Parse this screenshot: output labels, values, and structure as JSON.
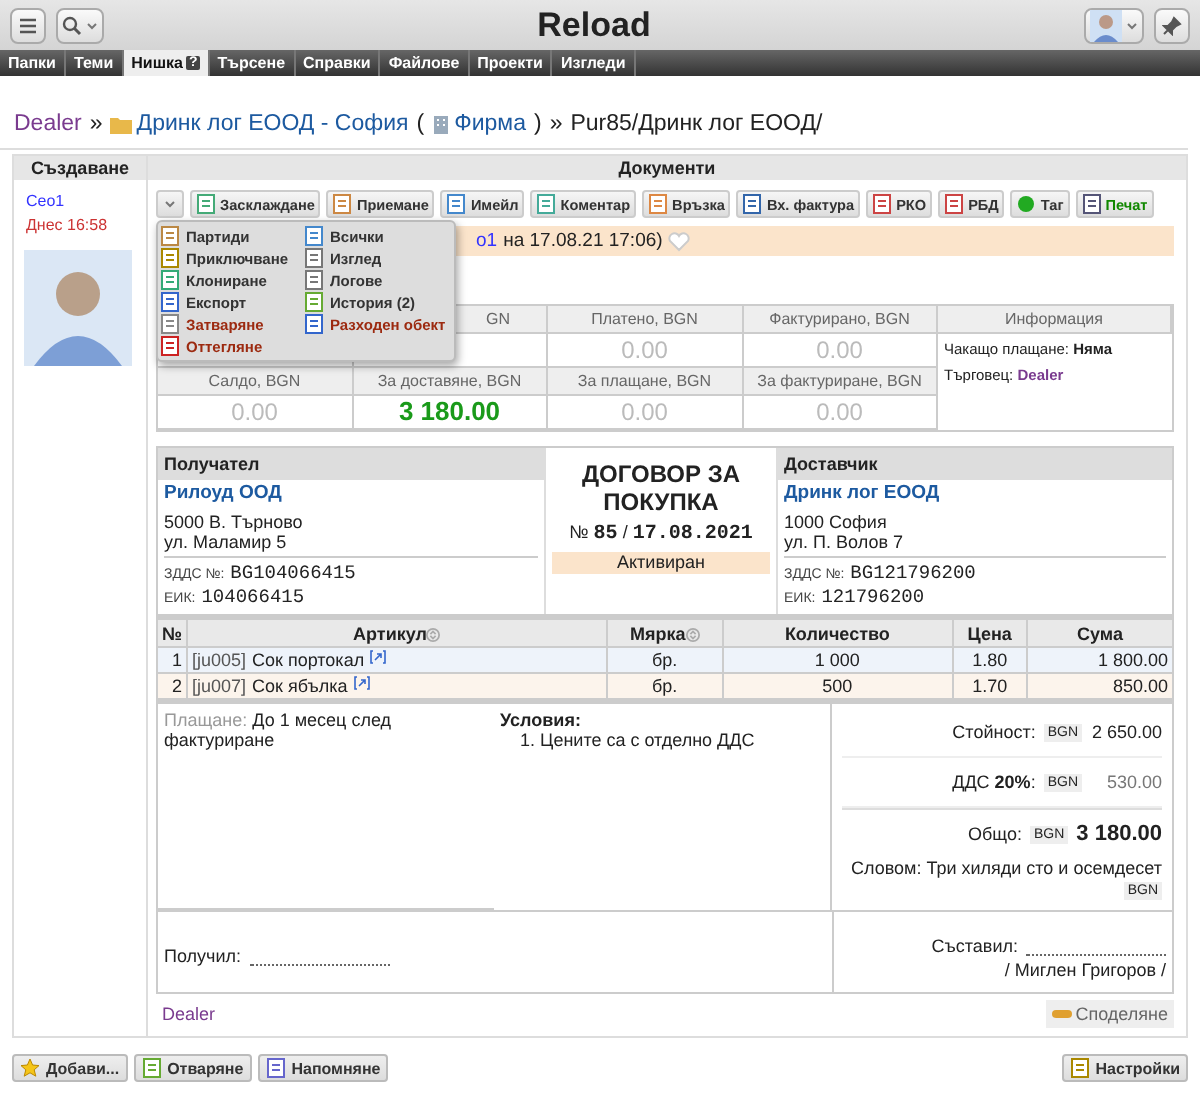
{
  "topbar": {
    "title": "Reload"
  },
  "tabs": [
    {
      "label": "Папки",
      "selected": false
    },
    {
      "label": "Теми",
      "selected": false
    },
    {
      "label": "Нишка",
      "selected": true,
      "help": "?"
    },
    {
      "label": "Търсене",
      "selected": false
    },
    {
      "label": "Справки",
      "selected": false
    },
    {
      "label": "Файлове",
      "selected": false
    },
    {
      "label": "Проекти",
      "selected": false
    },
    {
      "label": "Изгледи",
      "selected": false
    }
  ],
  "breadcrumb": [
    {
      "kind": "user",
      "text": "Dealer"
    },
    {
      "kind": "sep",
      "text": "»"
    },
    {
      "kind": "folder",
      "text": "Дринк лог ЕООД - София"
    },
    {
      "kind": "plain",
      "text": "("
    },
    {
      "kind": "company",
      "text": "Фирма"
    },
    {
      "kind": "plain",
      "text": ")"
    },
    {
      "kind": "sep",
      "text": "»"
    },
    {
      "kind": "plain",
      "text": "Pur85/Дринк лог ЕООД/"
    }
  ],
  "left": {
    "header": "Създаване",
    "author": "Сео1",
    "time": "Днес 16:58"
  },
  "documents": {
    "header": "Документи"
  },
  "toolbar": [
    {
      "label": "Засклаждане",
      "kind": "normal"
    },
    {
      "label": "Приемане",
      "kind": "normal"
    },
    {
      "label": "Имейл",
      "kind": "normal"
    },
    {
      "label": "Коментар",
      "kind": "normal"
    },
    {
      "label": "Връзка",
      "kind": "normal"
    },
    {
      "label": "Вх. фактура",
      "kind": "normal"
    },
    {
      "label": "РКО",
      "kind": "normal"
    },
    {
      "label": "РБД",
      "kind": "normal"
    },
    {
      "label": "Таг",
      "kind": "normal"
    },
    {
      "label": "Печат",
      "kind": "primary"
    }
  ],
  "menu": [
    {
      "label": "Партиди",
      "kind": "normal"
    },
    {
      "label": "Всички",
      "kind": "normal"
    },
    {
      "label": "Приключване",
      "kind": "normal"
    },
    {
      "label": "Изглед",
      "kind": "normal"
    },
    {
      "label": "Клониране",
      "kind": "normal"
    },
    {
      "label": "Логове",
      "kind": "normal"
    },
    {
      "label": "Експорт",
      "kind": "normal"
    },
    {
      "label": "История (2)",
      "kind": "normal"
    },
    {
      "label": "Затваряне",
      "kind": "danger"
    },
    {
      "label": "Разходен обект",
      "kind": "danger"
    },
    {
      "label": "Оттегляне",
      "kind": "danger"
    }
  ],
  "notice": {
    "link": "о1",
    "text": "на 17.08.21 17:06)"
  },
  "stats": {
    "columns": [
      {
        "header_2": "Салдо, BGN",
        "value_2": "0.00",
        "kind": "plain"
      },
      {
        "header_1": "GN",
        "header_2": "За доставяне, BGN",
        "value_2": "3 180.00",
        "kind": "highlight"
      },
      {
        "header_1": "Платено, BGN",
        "value_1": "0.00",
        "header_2": "За плащане, BGN",
        "value_2": "0.00",
        "kind": "plain"
      },
      {
        "header_1": "Фактурирано, BGN",
        "value_1": "0.00",
        "header_2": "За фактуриране, BGN",
        "value_2": "0.00",
        "kind": "plain"
      }
    ],
    "info_header": "Информация",
    "info": [
      {
        "label": "Чакащо плащане:",
        "value": "Няма",
        "kind": "bold"
      },
      {
        "label": "Търговец:",
        "value": "Dealer",
        "kind": "link"
      }
    ]
  },
  "contract": {
    "recipient": {
      "header": "Получател",
      "name": "Рилоуд ООД",
      "address": [
        "5000 В. Търново",
        "ул. Маламир 5"
      ],
      "vat_label": "ЗДДС №:",
      "vat": "BG104066415",
      "eik_label": "ЕИК:",
      "eik": "104066415"
    },
    "title": "ДОГОВОР ЗА ПОКУПКА",
    "number_sign": "№",
    "number": "85",
    "slash": "/",
    "date": "17.08.2021",
    "status": "Активиран",
    "supplier": {
      "header": "Доставчик",
      "name": "Дринк лог ЕООД",
      "address": [
        "1000 София",
        "ул. П. Волов 7"
      ],
      "vat_label": "ЗДДС №:",
      "vat": "BG121796200",
      "eik_label": "ЕИК:",
      "eik": "121796200"
    }
  },
  "items": {
    "columns": [
      {
        "label": "№",
        "sortable": false
      },
      {
        "label": "Артикул",
        "sortable": true
      },
      {
        "label": "Мярка",
        "sortable": true
      },
      {
        "label": "Количество",
        "sortable": false
      },
      {
        "label": "Цена",
        "sortable": false
      },
      {
        "label": "Сума",
        "sortable": false
      }
    ],
    "rows": [
      {
        "no": "1",
        "code": "[ju005]",
        "name": "Сок портокал",
        "unit": "бр.",
        "qty": "1 000",
        "price": "1.80",
        "sum": "1 800.00"
      },
      {
        "no": "2",
        "code": "[ju007]",
        "name": "Сок ябълка",
        "unit": "бр.",
        "qty": "500",
        "price": "1.70",
        "sum": "850.00"
      }
    ]
  },
  "footer": {
    "payment_label": "Плащане:",
    "payment": "До 1 месец след фактуриране",
    "conditions_title": "Условия:",
    "conditions": [
      {
        "number": "1.",
        "text": "Цените са с отделно ДДС"
      }
    ],
    "totals": [
      {
        "label": "Стойност:",
        "currency": "BGN",
        "value": "2 650.00",
        "kind": "normal"
      },
      {
        "label": "ДДС **20%**:",
        "currency": "BGN",
        "value": "530.00",
        "kind": "muted"
      },
      {
        "label": "Общо:",
        "currency": "BGN",
        "value": "3 180.00",
        "kind": "total"
      }
    ],
    "words": "Словом: Три хиляди сто и осемдесет",
    "words_currency": "BGN",
    "received_label": "Получил:",
    "composed_label": "Съставил:",
    "composed_name": "/ Миглен Григоров /"
  },
  "doc_footer": {
    "user": "Dealer",
    "share": "Споделяне"
  },
  "bottom_buttons": [
    "Добави...",
    "Отваряне",
    "Напомняне"
  ],
  "settings_button": "Настройки"
}
